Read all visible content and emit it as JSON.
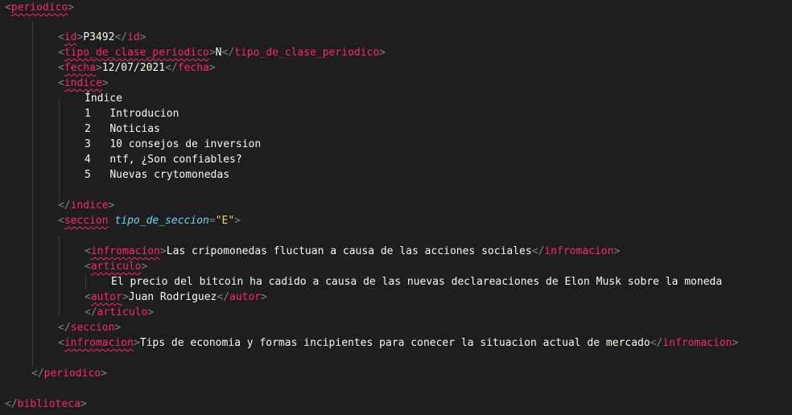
{
  "editor": {
    "colors": {
      "background": "#1e1e1e",
      "tag": "#f92672",
      "punctuation": "#808080",
      "attribute": "#66d9ef",
      "string": "#e6db74",
      "text": "#f8f8f2"
    },
    "tags": {
      "periodico": "periodico",
      "id": "id",
      "tipo_clase": "tipo_de_clase_periodico",
      "fecha": "fecha",
      "indice": "indice",
      "seccion": "seccion",
      "infromacion": "infromacion",
      "articulo": "articulo",
      "autor": "autor",
      "biblioteca": "biblioteca"
    },
    "values": {
      "id": "P3492",
      "tipo_clase": "N",
      "fecha": "12/07/2021",
      "seccion_attr_name": "tipo_de_seccion",
      "seccion_attr_value": "E",
      "informacion_1": "Las cripomonedas fluctuan a causa de las acciones sociales",
      "articulo_text": "El precio del bitcoin ha cadido a causa de las nuevas declareaciones de Elon Musk sobre la moneda",
      "autor": "Juan Rodriguez",
      "informacion_2": "Tips de economia y formas incipientes para conecer la situacion actual de mercado"
    },
    "indice": {
      "heading": "Índice",
      "items": [
        {
          "num": "1",
          "label": "Introducion"
        },
        {
          "num": "2",
          "label": "Noticias"
        },
        {
          "num": "3",
          "label": "10 consejos de inversion"
        },
        {
          "num": "4",
          "label": "ntf, ¿Son confiables?"
        },
        {
          "num": "5",
          "label": "Nuevas crytomonedas"
        }
      ]
    }
  }
}
